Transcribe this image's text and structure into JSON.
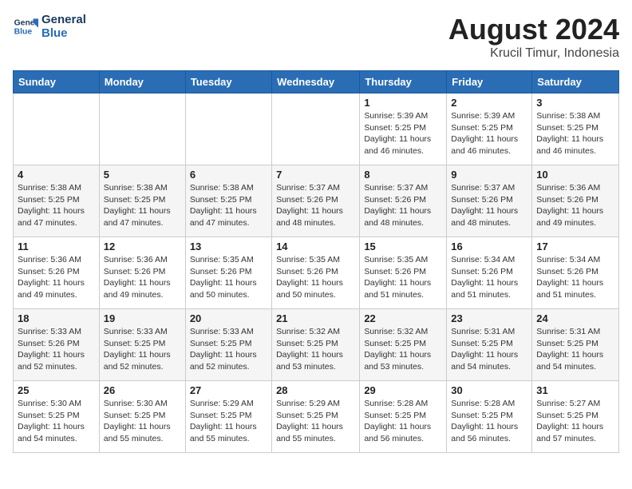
{
  "logo": {
    "line1": "General",
    "line2": "Blue"
  },
  "title": "August 2024",
  "location": "Krucil Timur, Indonesia",
  "weekdays": [
    "Sunday",
    "Monday",
    "Tuesday",
    "Wednesday",
    "Thursday",
    "Friday",
    "Saturday"
  ],
  "weeks": [
    [
      {
        "day": "",
        "detail": ""
      },
      {
        "day": "",
        "detail": ""
      },
      {
        "day": "",
        "detail": ""
      },
      {
        "day": "",
        "detail": ""
      },
      {
        "day": "1",
        "detail": "Sunrise: 5:39 AM\nSunset: 5:25 PM\nDaylight: 11 hours\nand 46 minutes."
      },
      {
        "day": "2",
        "detail": "Sunrise: 5:39 AM\nSunset: 5:25 PM\nDaylight: 11 hours\nand 46 minutes."
      },
      {
        "day": "3",
        "detail": "Sunrise: 5:38 AM\nSunset: 5:25 PM\nDaylight: 11 hours\nand 46 minutes."
      }
    ],
    [
      {
        "day": "4",
        "detail": "Sunrise: 5:38 AM\nSunset: 5:25 PM\nDaylight: 11 hours\nand 47 minutes."
      },
      {
        "day": "5",
        "detail": "Sunrise: 5:38 AM\nSunset: 5:25 PM\nDaylight: 11 hours\nand 47 minutes."
      },
      {
        "day": "6",
        "detail": "Sunrise: 5:38 AM\nSunset: 5:25 PM\nDaylight: 11 hours\nand 47 minutes."
      },
      {
        "day": "7",
        "detail": "Sunrise: 5:37 AM\nSunset: 5:26 PM\nDaylight: 11 hours\nand 48 minutes."
      },
      {
        "day": "8",
        "detail": "Sunrise: 5:37 AM\nSunset: 5:26 PM\nDaylight: 11 hours\nand 48 minutes."
      },
      {
        "day": "9",
        "detail": "Sunrise: 5:37 AM\nSunset: 5:26 PM\nDaylight: 11 hours\nand 48 minutes."
      },
      {
        "day": "10",
        "detail": "Sunrise: 5:36 AM\nSunset: 5:26 PM\nDaylight: 11 hours\nand 49 minutes."
      }
    ],
    [
      {
        "day": "11",
        "detail": "Sunrise: 5:36 AM\nSunset: 5:26 PM\nDaylight: 11 hours\nand 49 minutes."
      },
      {
        "day": "12",
        "detail": "Sunrise: 5:36 AM\nSunset: 5:26 PM\nDaylight: 11 hours\nand 49 minutes."
      },
      {
        "day": "13",
        "detail": "Sunrise: 5:35 AM\nSunset: 5:26 PM\nDaylight: 11 hours\nand 50 minutes."
      },
      {
        "day": "14",
        "detail": "Sunrise: 5:35 AM\nSunset: 5:26 PM\nDaylight: 11 hours\nand 50 minutes."
      },
      {
        "day": "15",
        "detail": "Sunrise: 5:35 AM\nSunset: 5:26 PM\nDaylight: 11 hours\nand 51 minutes."
      },
      {
        "day": "16",
        "detail": "Sunrise: 5:34 AM\nSunset: 5:26 PM\nDaylight: 11 hours\nand 51 minutes."
      },
      {
        "day": "17",
        "detail": "Sunrise: 5:34 AM\nSunset: 5:26 PM\nDaylight: 11 hours\nand 51 minutes."
      }
    ],
    [
      {
        "day": "18",
        "detail": "Sunrise: 5:33 AM\nSunset: 5:26 PM\nDaylight: 11 hours\nand 52 minutes."
      },
      {
        "day": "19",
        "detail": "Sunrise: 5:33 AM\nSunset: 5:25 PM\nDaylight: 11 hours\nand 52 minutes."
      },
      {
        "day": "20",
        "detail": "Sunrise: 5:33 AM\nSunset: 5:25 PM\nDaylight: 11 hours\nand 52 minutes."
      },
      {
        "day": "21",
        "detail": "Sunrise: 5:32 AM\nSunset: 5:25 PM\nDaylight: 11 hours\nand 53 minutes."
      },
      {
        "day": "22",
        "detail": "Sunrise: 5:32 AM\nSunset: 5:25 PM\nDaylight: 11 hours\nand 53 minutes."
      },
      {
        "day": "23",
        "detail": "Sunrise: 5:31 AM\nSunset: 5:25 PM\nDaylight: 11 hours\nand 54 minutes."
      },
      {
        "day": "24",
        "detail": "Sunrise: 5:31 AM\nSunset: 5:25 PM\nDaylight: 11 hours\nand 54 minutes."
      }
    ],
    [
      {
        "day": "25",
        "detail": "Sunrise: 5:30 AM\nSunset: 5:25 PM\nDaylight: 11 hours\nand 54 minutes."
      },
      {
        "day": "26",
        "detail": "Sunrise: 5:30 AM\nSunset: 5:25 PM\nDaylight: 11 hours\nand 55 minutes."
      },
      {
        "day": "27",
        "detail": "Sunrise: 5:29 AM\nSunset: 5:25 PM\nDaylight: 11 hours\nand 55 minutes."
      },
      {
        "day": "28",
        "detail": "Sunrise: 5:29 AM\nSunset: 5:25 PM\nDaylight: 11 hours\nand 55 minutes."
      },
      {
        "day": "29",
        "detail": "Sunrise: 5:28 AM\nSunset: 5:25 PM\nDaylight: 11 hours\nand 56 minutes."
      },
      {
        "day": "30",
        "detail": "Sunrise: 5:28 AM\nSunset: 5:25 PM\nDaylight: 11 hours\nand 56 minutes."
      },
      {
        "day": "31",
        "detail": "Sunrise: 5:27 AM\nSunset: 5:25 PM\nDaylight: 11 hours\nand 57 minutes."
      }
    ]
  ]
}
